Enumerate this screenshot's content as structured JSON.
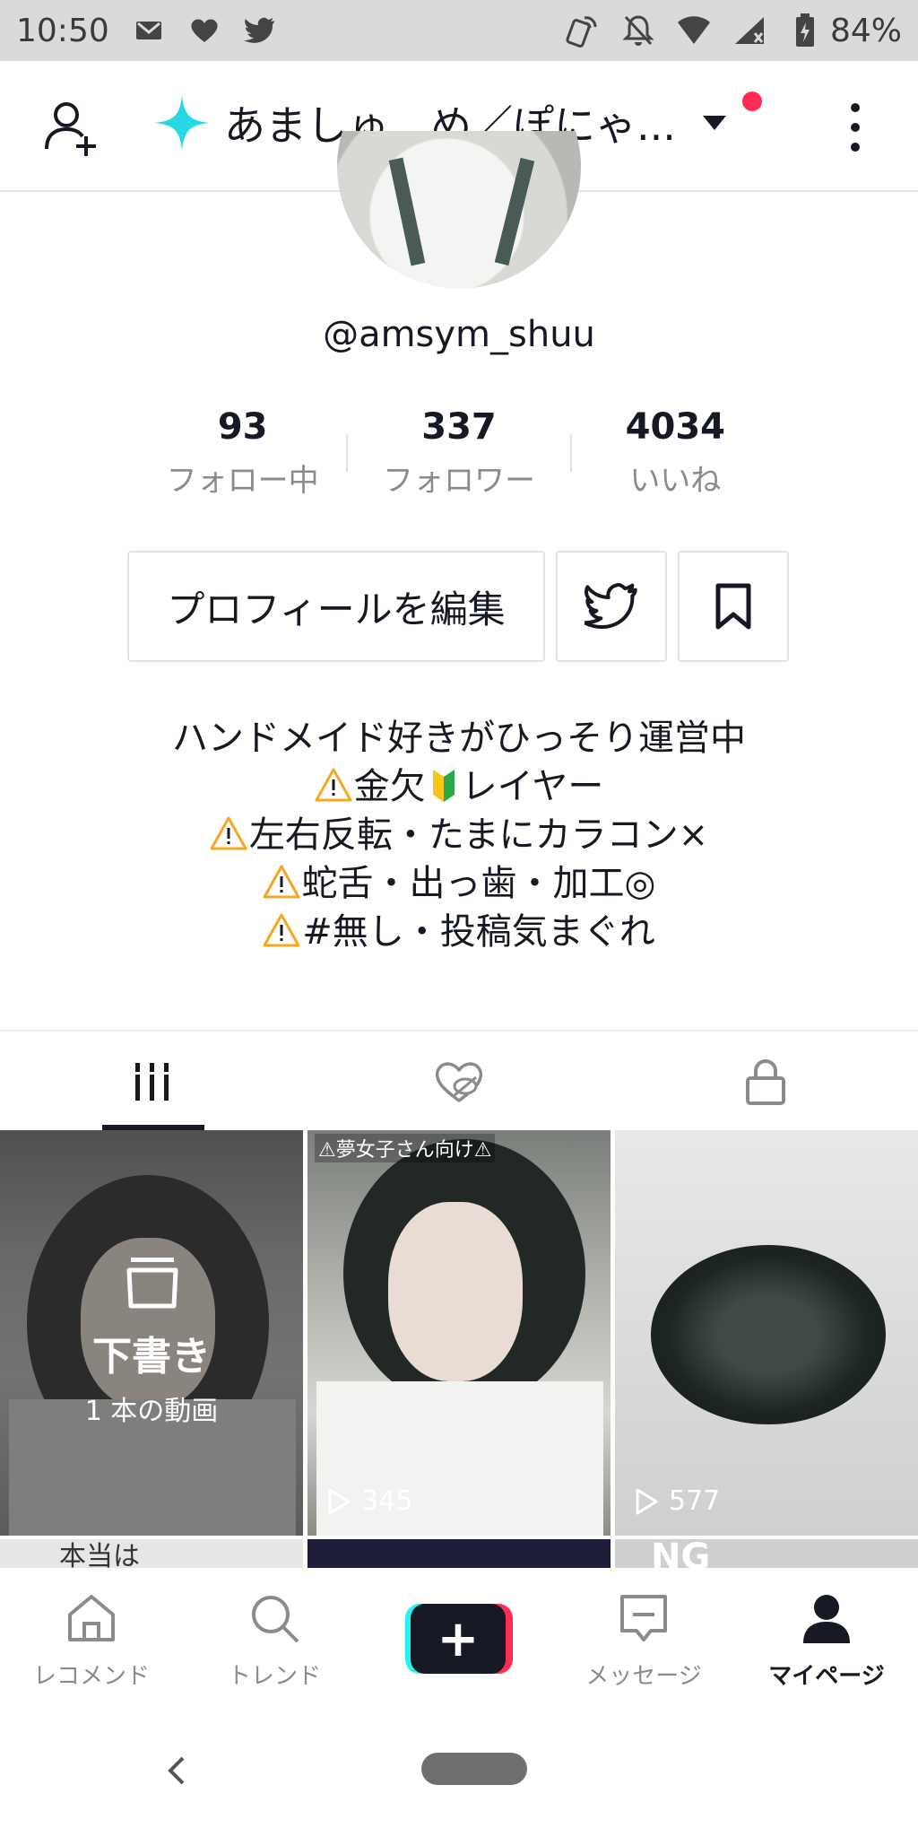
{
  "status_bar": {
    "time": "10:50",
    "battery": "84%"
  },
  "header": {
    "account_name": "あましゅ、め／ぽにゃ..."
  },
  "profile": {
    "username": "@amsym_shuu",
    "stats": [
      {
        "value": "93",
        "label": "フォロー中"
      },
      {
        "value": "337",
        "label": "フォロワー"
      },
      {
        "value": "4034",
        "label": "いいね"
      }
    ],
    "edit_button": "プロフィールを編集",
    "bio": {
      "line1": "ハンドメイド好きがひっそり運営中",
      "line2a": "金欠",
      "line2b": "レイヤー",
      "line3": "左右反転・たまにカラコン×",
      "line4": "蛇舌・出っ歯・加工◎",
      "line5": "#無し・投稿気まぐれ"
    }
  },
  "grid": {
    "draft": {
      "title": "下書き",
      "subtitle": "1 本の動画"
    },
    "video2": {
      "caption": "⚠夢女子さん向け⚠",
      "views": "345"
    },
    "video3": {
      "views": "577"
    },
    "row2": {
      "item1_text": "本当は",
      "item3_text": "NG"
    }
  },
  "bottom_nav": {
    "items": [
      {
        "label": "レコメンド"
      },
      {
        "label": "トレンド"
      },
      {
        "label": "メッセージ"
      },
      {
        "label": "マイページ"
      }
    ]
  },
  "colors": {
    "accent": "#fe2c55",
    "cyan": "#25f4ee",
    "text": "#161823",
    "muted": "#8a8b91"
  }
}
